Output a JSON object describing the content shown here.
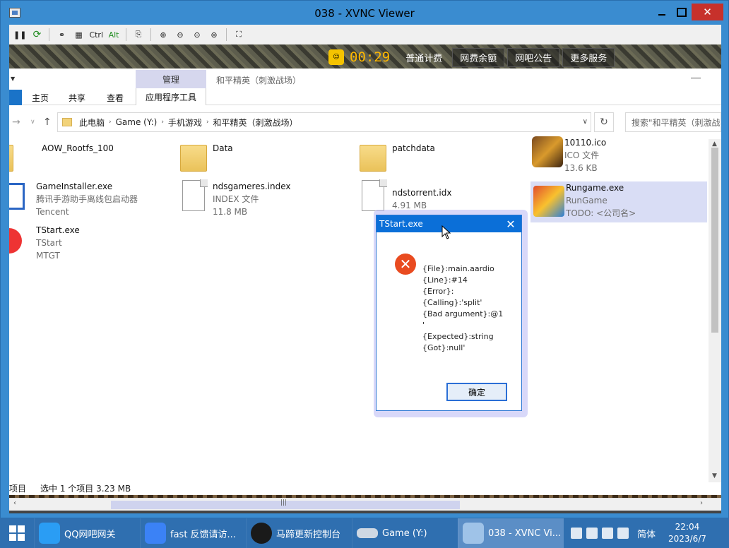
{
  "window": {
    "title": "038 - XVNC Viewer"
  },
  "toolbar": {
    "ctrl_label": "Ctrl",
    "alt_label": "Alt"
  },
  "cafe": {
    "timer": "00:29",
    "items": [
      "普通计费",
      "网费余额",
      "网吧公告",
      "更多服务"
    ]
  },
  "explorer": {
    "context_tab": "管理",
    "title": "和平精英（刺激战场）",
    "tabs": {
      "home": "主页",
      "share": "共享",
      "view": "查看",
      "app_tools": "应用程序工具"
    },
    "breadcrumbs": [
      "此电脑",
      "Game (Y:)",
      "手机游戏",
      "和平精英（刺激战场）"
    ],
    "search_placeholder": "搜索\"和平精英（刺激战场）\"",
    "files": [
      {
        "name": "AOW_Rootfs_100",
        "line2": "",
        "line3": "",
        "icon": "folder-partial"
      },
      {
        "name": "Data",
        "line2": "",
        "line3": "",
        "icon": "folder"
      },
      {
        "name": "patchdata",
        "line2": "",
        "line3": "",
        "icon": "folder"
      },
      {
        "name": "10110.ico",
        "line2": "ICO 文件",
        "line3": "13.6 KB",
        "icon": "game-icon"
      },
      {
        "name": "GameInstaller.exe",
        "line2": "腾讯手游助手离线包启动器",
        "line3": "Tencent",
        "icon": "window"
      },
      {
        "name": "ndsgameres.index",
        "line2": "INDEX 文件",
        "line3": "11.8 MB",
        "icon": "document"
      },
      {
        "name": "ndstorrent.idx",
        "line2": "4.91 MB",
        "line3": "",
        "icon": "document"
      },
      {
        "name": "Rungame.exe",
        "line2": "RunGame",
        "line3": "TODO: <公司名>",
        "icon": "app"
      },
      {
        "name": "TStart.exe",
        "line2": "TStart",
        "line3": "MTGT",
        "icon": "red-app"
      }
    ],
    "status": {
      "count": "项目",
      "selected": "选中 1 个项目  3.23 MB"
    }
  },
  "dialog": {
    "title": "TStart.exe",
    "lines": [
      "{File}:main.aardio",
      "{Line}:#14",
      "{Error}:",
      "{Calling}:'split'",
      "{Bad argument}:@1",
      "'",
      "{Expected}:string",
      "{Got}:null'"
    ],
    "ok_label": "确定"
  },
  "taskbar": {
    "tasks": [
      {
        "label": "QQ网吧网关",
        "icon": "qq-cafe-icon",
        "color": "#2a9df4"
      },
      {
        "label": "fast 反馈请访...",
        "icon": "rocket-icon",
        "color": "#3b82f6"
      },
      {
        "label": "马蹄更新控制台",
        "icon": "m-logo-icon",
        "color": "#1a1a1a"
      },
      {
        "label": "Game (Y:)",
        "icon": "drive-icon",
        "color": "#cfd8e3"
      },
      {
        "label": "038 - XVNC Vi...",
        "icon": "vnc-icon",
        "color": "#9fc3e8"
      }
    ],
    "ime": "简体",
    "time": "22:04",
    "date": "2023/6/7"
  }
}
